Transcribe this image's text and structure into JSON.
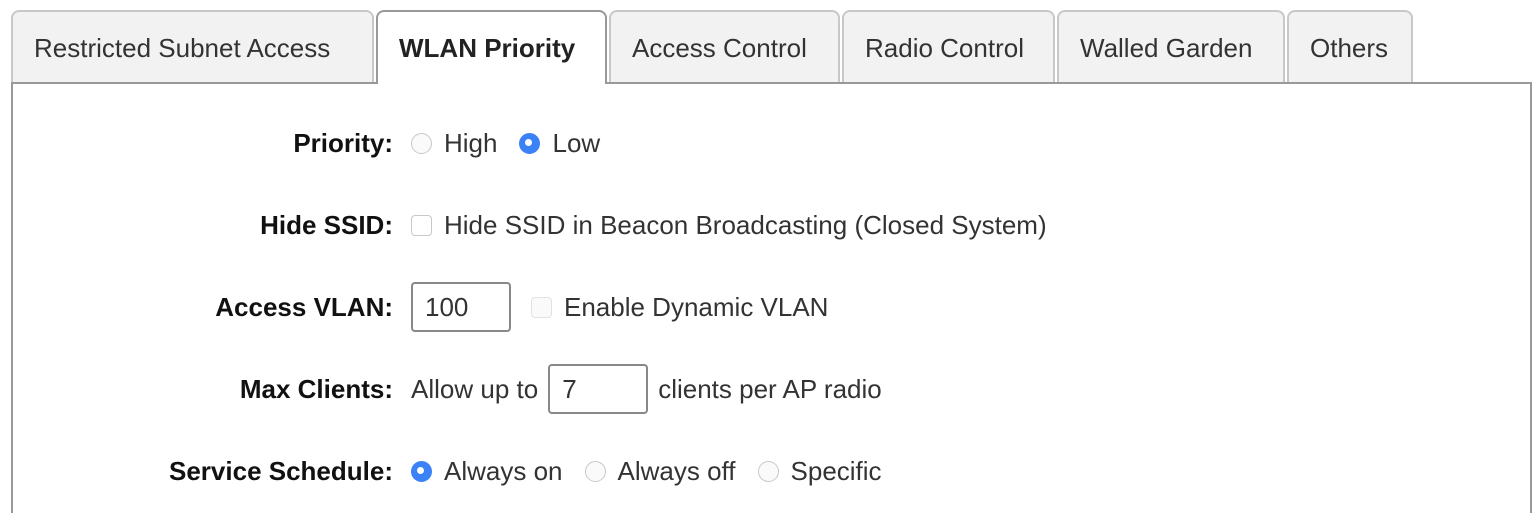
{
  "tabs": [
    {
      "label": "Restricted Subnet Access",
      "active": false
    },
    {
      "label": "WLAN Priority",
      "active": true
    },
    {
      "label": "Access Control",
      "active": false
    },
    {
      "label": "Radio Control",
      "active": false
    },
    {
      "label": "Walled Garden",
      "active": false
    },
    {
      "label": "Others",
      "active": false
    }
  ],
  "form": {
    "priority": {
      "label": "Priority:",
      "options": [
        "High",
        "Low"
      ],
      "selected": "Low"
    },
    "hide_ssid": {
      "label": "Hide SSID:",
      "checkbox_label": "Hide SSID in Beacon Broadcasting (Closed System)",
      "checked": false
    },
    "access_vlan": {
      "label": "Access VLAN:",
      "value": "100",
      "dynamic_label": "Enable Dynamic VLAN",
      "dynamic_checked": false,
      "dynamic_disabled": true
    },
    "max_clients": {
      "label": "Max Clients:",
      "prefix": "Allow up to",
      "value": "7",
      "suffix": "clients per AP radio"
    },
    "service_schedule": {
      "label": "Service Schedule:",
      "options": [
        "Always on",
        "Always off",
        "Specific"
      ],
      "selected": "Always on"
    }
  },
  "colors": {
    "accent": "#3b82f6",
    "tab_bg": "#f2f2f2",
    "border": "#999999"
  }
}
